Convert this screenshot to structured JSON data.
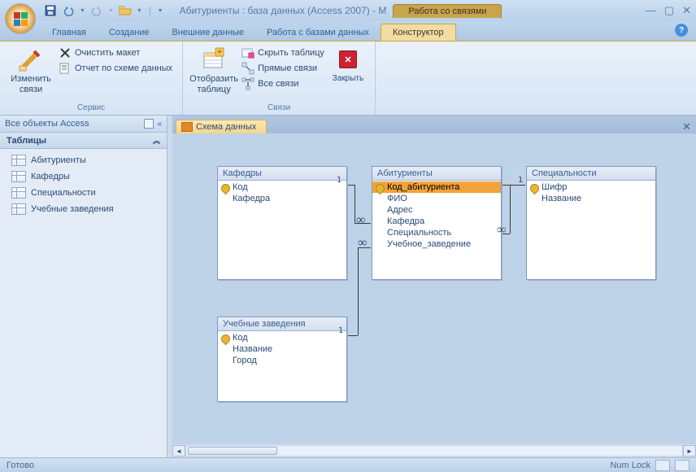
{
  "title": "Абитуриенты : база данных (Access 2007) - M",
  "context_tab": "Работа со связями",
  "tabs": {
    "home": "Главная",
    "create": "Создание",
    "external": "Внешние данные",
    "database": "Работа с базами данных",
    "designer": "Конструктор"
  },
  "ribbon": {
    "edit_rel": {
      "line1": "Изменить",
      "line2": "связи"
    },
    "clear_layout": "Очистить макет",
    "schema_report": "Отчет по схеме данных",
    "group_service": "Сервис",
    "show_table": {
      "line1": "Отобразить",
      "line2": "таблицу"
    },
    "hide_table": "Скрыть таблицу",
    "direct_rel": "Прямые связи",
    "all_rel": "Все связи",
    "group_rel": "Связи",
    "close": "Закрыть"
  },
  "nav": {
    "header": "Все объекты Access",
    "category": "Таблицы",
    "items": [
      "Абитуриенты",
      "Кафедры",
      "Специальности",
      "Учебные заведения"
    ]
  },
  "doc_tab": "Схема данных",
  "tables": {
    "t1": {
      "title": "Кафедры",
      "fields": [
        "Код",
        "Кафедра"
      ]
    },
    "t2": {
      "title": "Абитуриенты",
      "fields": [
        "Код_абитуриента",
        "ФИО",
        "Адрес",
        "Кафедра",
        "Специальность",
        "Учебное_заведение"
      ]
    },
    "t3": {
      "title": "Специальности",
      "fields": [
        "Шифр",
        "Название"
      ]
    },
    "t4": {
      "title": "Учебные заведения",
      "fields": [
        "Код",
        "Название",
        "Город"
      ]
    }
  },
  "rel_one": "1",
  "rel_inf": "∞",
  "status": {
    "ready": "Готово",
    "numlock": "Num Lock"
  }
}
